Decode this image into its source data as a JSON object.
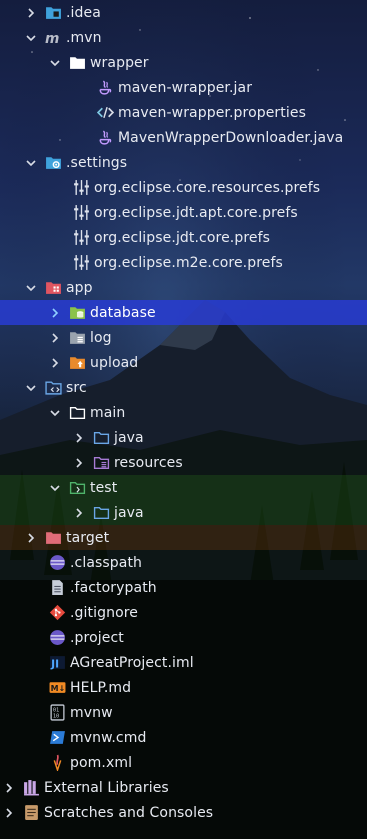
{
  "tree": {
    "items": [
      {
        "label": ".idea"
      },
      {
        "label": ".mvn"
      },
      {
        "label": "wrapper"
      },
      {
        "label": "maven-wrapper.jar"
      },
      {
        "label": "maven-wrapper.properties"
      },
      {
        "label": "MavenWrapperDownloader.java"
      },
      {
        "label": ".settings"
      },
      {
        "label": "org.eclipse.core.resources.prefs"
      },
      {
        "label": "org.eclipse.jdt.apt.core.prefs"
      },
      {
        "label": "org.eclipse.jdt.core.prefs"
      },
      {
        "label": "org.eclipse.m2e.core.prefs"
      },
      {
        "label": "app"
      },
      {
        "label": "database"
      },
      {
        "label": "log"
      },
      {
        "label": "upload"
      },
      {
        "label": "src"
      },
      {
        "label": "main"
      },
      {
        "label": "java"
      },
      {
        "label": "resources"
      },
      {
        "label": "test"
      },
      {
        "label": "java"
      },
      {
        "label": "target"
      },
      {
        "label": ".classpath"
      },
      {
        "label": ".factorypath"
      },
      {
        "label": ".gitignore"
      },
      {
        "label": ".project"
      },
      {
        "label": "AGreatProject.iml"
      },
      {
        "label": "HELP.md"
      },
      {
        "label": "mvnw"
      },
      {
        "label": "mvnw.cmd"
      },
      {
        "label": "pom.xml"
      },
      {
        "label": "External Libraries"
      },
      {
        "label": "Scratches and Consoles"
      }
    ]
  },
  "colors": {
    "selection": "#2a3cd6",
    "folder_blue": "#6aa6e6",
    "folder_red": "#e05561",
    "folder_orange": "#e98a2c",
    "folder_green": "#4fb36b",
    "eclipse_purple": "#6a58c8"
  }
}
